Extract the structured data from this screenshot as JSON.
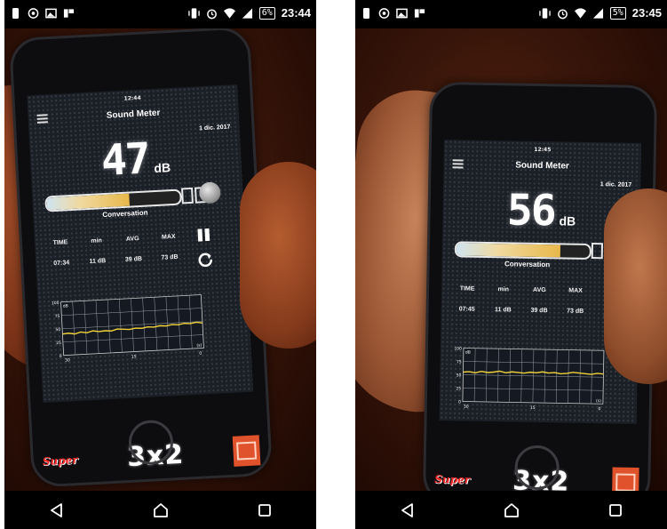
{
  "screenshots": [
    {
      "status_bar": {
        "battery": "6%",
        "clock": "23:44"
      },
      "app": {
        "time": "12:44",
        "title": "Sound Meter",
        "date": "1 dic. 2017",
        "db_value": "47",
        "db_unit": "dB",
        "level_fraction": 0.62,
        "level_label": "Conversation",
        "stats_headers": [
          "TIME",
          "min",
          "AVG",
          "MAX"
        ],
        "stats_values": [
          "07:34",
          "11 dB",
          "39 dB",
          "73 dB"
        ],
        "chart_data": {
          "type": "line",
          "yticks": [
            "100",
            "75",
            "50",
            "25",
            "0"
          ],
          "xticks": [
            "30",
            "15",
            "0"
          ],
          "y_unit": "dB",
          "x_unit": "(s)",
          "ylim": [
            0,
            100
          ],
          "series": [
            {
              "values": [
                40,
                41,
                39,
                42,
                40,
                43,
                41,
                42,
                41,
                44,
                43,
                42,
                44,
                43,
                45,
                44,
                46,
                45,
                47,
                46,
                48,
                47,
                49,
                47
              ]
            }
          ]
        }
      },
      "ad": {
        "super": "Super",
        "promo": "3x2"
      }
    },
    {
      "status_bar": {
        "battery": "5%",
        "clock": "23:45"
      },
      "app": {
        "time": "12:45",
        "title": "Sound Meter",
        "date": "1 dic. 2017",
        "db_value": "56",
        "db_unit": "dB",
        "level_fraction": 0.78,
        "level_label": "Conversation",
        "stats_headers": [
          "TIME",
          "min",
          "AVG",
          "MAX"
        ],
        "stats_values": [
          "07:45",
          "11 dB",
          "39 dB",
          "73 dB"
        ],
        "chart_data": {
          "type": "line",
          "yticks": [
            "100",
            "75",
            "50",
            "25",
            "0"
          ],
          "xticks": [
            "30",
            "15",
            "0"
          ],
          "y_unit": "dB",
          "x_unit": "(s)",
          "ylim": [
            0,
            100
          ],
          "series": [
            {
              "values": [
                55,
                56,
                54,
                57,
                55,
                56,
                58,
                55,
                57,
                56,
                55,
                57,
                56,
                58,
                56,
                57,
                55,
                56,
                58,
                57,
                56,
                55,
                57,
                56
              ]
            }
          ]
        }
      },
      "ad": {
        "super": "Super",
        "promo": "3x2"
      }
    }
  ],
  "nav": {
    "icons": [
      "back-icon",
      "home-icon",
      "recents-icon"
    ]
  }
}
